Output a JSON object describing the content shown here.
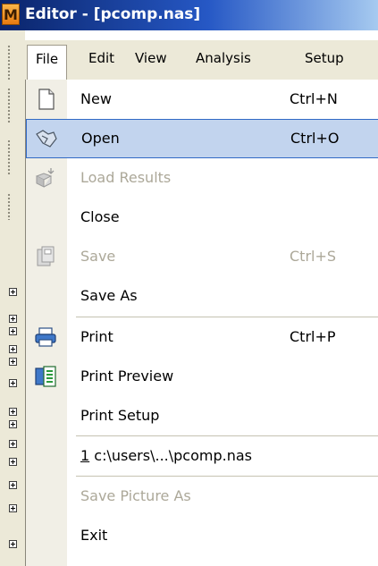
{
  "window": {
    "app_icon_letter": "M",
    "title": "Editor - [pcomp.nas]"
  },
  "menubar": {
    "items": [
      {
        "label": "File",
        "active": true
      },
      {
        "label": "Edit"
      },
      {
        "label": "View"
      },
      {
        "label": "Analysis"
      },
      {
        "label": "Setup"
      }
    ]
  },
  "file_menu": {
    "items": [
      {
        "label": "New",
        "shortcut": "Ctrl+N",
        "enabled": true,
        "icon": "new-document-icon"
      },
      {
        "label": "Open",
        "shortcut": "Ctrl+O",
        "enabled": true,
        "highlighted": true,
        "icon": "open-folder-icon"
      },
      {
        "label": "Load Results",
        "shortcut": "",
        "enabled": false,
        "icon": "load-results-icon"
      },
      {
        "label": "Close",
        "shortcut": "",
        "enabled": true
      },
      {
        "label": "Save",
        "shortcut": "Ctrl+S",
        "enabled": false,
        "icon": "save-disk-icon"
      },
      {
        "label": "Save As",
        "shortcut": "",
        "enabled": true
      },
      {
        "label": "Print",
        "shortcut": "Ctrl+P",
        "enabled": true,
        "icon": "printer-icon"
      },
      {
        "label": "Print Preview",
        "shortcut": "",
        "enabled": true,
        "icon": "print-preview-icon"
      },
      {
        "label": "Print Setup",
        "shortcut": "",
        "enabled": true
      },
      {
        "label_prefix": "1",
        "label": " c:\\users\\...\\pcomp.nas",
        "shortcut": "",
        "enabled": true
      },
      {
        "label": "Save Picture As",
        "shortcut": "",
        "enabled": false
      },
      {
        "label": "Exit",
        "shortcut": "",
        "enabled": true
      }
    ]
  },
  "colors": {
    "highlight_fill": "#c2d4ee",
    "highlight_border": "#316ac5",
    "disabled_text": "#aca899",
    "title_gradient_start": "#0a246a"
  }
}
